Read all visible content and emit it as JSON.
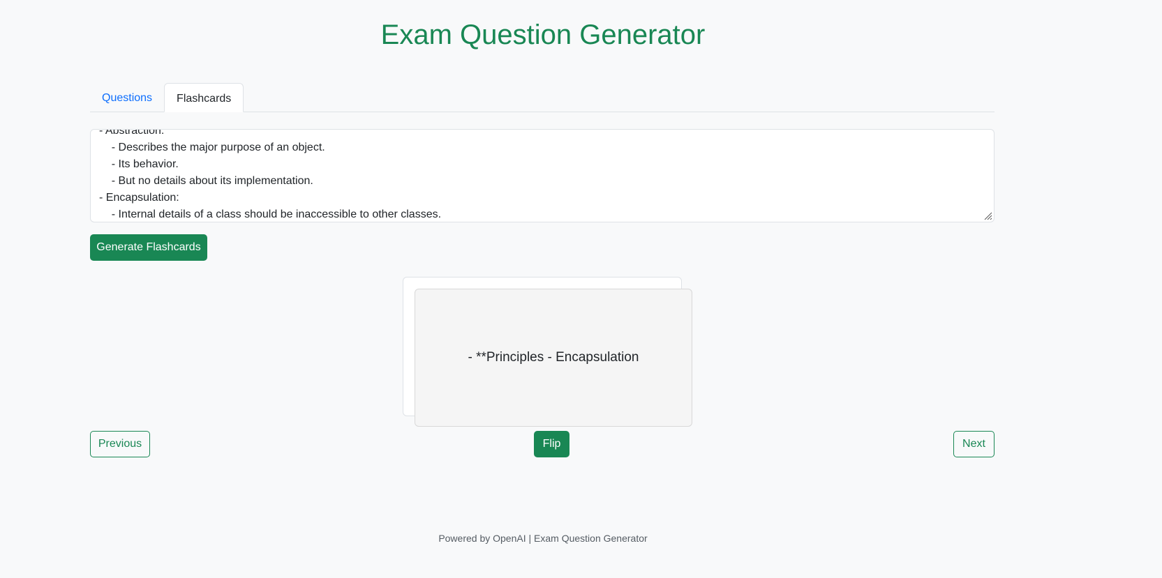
{
  "header": {
    "title": "Exam Question Generator"
  },
  "tabs": [
    {
      "label": "Questions",
      "active": false
    },
    {
      "label": "Flashcards",
      "active": true
    }
  ],
  "notes_input": {
    "value": "- Abstraction:\n    - Describes the major purpose of an object.\n    - Its behavior.\n    - But no details about its implementation.\n- Encapsulation:\n    - Internal details of a class should be inaccessible to other classes."
  },
  "actions": {
    "generate_label": "Generate Flashcards",
    "previous_label": "Previous",
    "flip_label": "Flip",
    "next_label": "Next"
  },
  "flashcard": {
    "front_text": "- **Principles - Encapsulation"
  },
  "footer": {
    "text": "Powered by OpenAI | Exam Question Generator"
  },
  "colors": {
    "accent": "#198754",
    "link": "#0d6efd",
    "background": "#f8f9fa"
  }
}
